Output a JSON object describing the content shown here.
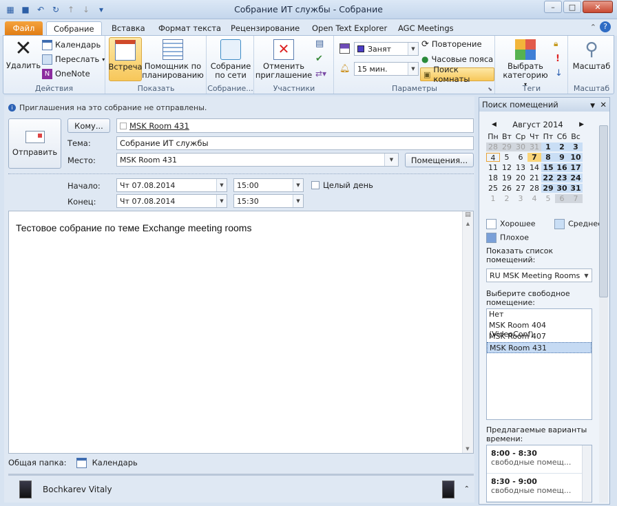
{
  "window": {
    "title": "Собрание ИТ службы - Собрание"
  },
  "tabs": [
    "Файл",
    "Собрание",
    "Вставка",
    "Формат текста",
    "Рецензирование",
    "Open Text Explorer",
    "AGC Meetings"
  ],
  "ribbon": {
    "groups": {
      "actions": "Действия",
      "show": "Показать",
      "online": "Собрание...",
      "attendees": "Участники",
      "options": "Параметры",
      "tags": "Теги",
      "zoom": "Масштаб"
    },
    "delete": "Удалить",
    "calendar": "Календарь",
    "forward": "Переслать",
    "onenote": "OneNote",
    "meeting": "Встреча",
    "scheduling": "Помощник по планированию",
    "online_meeting": "Собрание по сети",
    "cancel_invite": "Отменить приглашение",
    "status": "Занят",
    "reminder": "15 мин.",
    "recurrence": "Повторение",
    "timezones": "Часовые пояса",
    "room_finder": "Поиск комнаты",
    "categorize": "Выбрать категорию",
    "zoom_btn": "Масштаб"
  },
  "form": {
    "info": "Приглашения на это собрание не отправлены.",
    "send": "Отправить",
    "to_btn": "Кому...",
    "to_value": "MSK Room 431",
    "subject_label": "Тема:",
    "subject": "Собрание ИТ службы",
    "location_label": "Место:",
    "location": "MSK Room 431",
    "rooms_btn": "Помещения...",
    "start_label": "Начало:",
    "start_date": "Чт 07.08.2014",
    "start_time": "15:00",
    "end_label": "Конец:",
    "end_date": "Чт 07.08.2014",
    "end_time": "15:30",
    "allday": "Целый день",
    "body": "Тестовое собрание по теме Exchange meeting rooms",
    "shared_folder_label": "Общая папка:",
    "shared_folder": "Календарь",
    "person": "Bochkarev Vitaly"
  },
  "side": {
    "title": "Поиск помещений",
    "month": "Август 2014",
    "weekdays": [
      "Пн",
      "Вт",
      "Ср",
      "Чт",
      "Пт",
      "Сб",
      "Вс"
    ],
    "days": [
      "28",
      "29",
      "30",
      "31",
      "1",
      "2",
      "3",
      "4",
      "5",
      "6",
      "7",
      "8",
      "9",
      "10",
      "11",
      "12",
      "13",
      "14",
      "15",
      "16",
      "17",
      "18",
      "19",
      "20",
      "21",
      "22",
      "23",
      "24",
      "25",
      "26",
      "27",
      "28",
      "29",
      "30",
      "31",
      "1",
      "2",
      "3",
      "4",
      "5",
      "6",
      "7"
    ],
    "legend_good": "Хорошее",
    "legend_mid": "Среднее",
    "legend_bad": "Плохое",
    "show_rooms_label": "Показать список помещений:",
    "room_list": "RU MSK Meeting Rooms",
    "choose_label": "Выберите свободное помещение:",
    "rooms": [
      "Нет",
      "MSK Room 404 (VideoConf)",
      "MSK Room 407",
      "MSK Room 431"
    ],
    "suggest_label": "Предлагаемые варианты времени:",
    "slots": [
      {
        "time": "8:00 - 8:30",
        "desc": "свободные помещ..."
      },
      {
        "time": "8:30 - 9:00",
        "desc": "свободные помещ..."
      }
    ]
  }
}
